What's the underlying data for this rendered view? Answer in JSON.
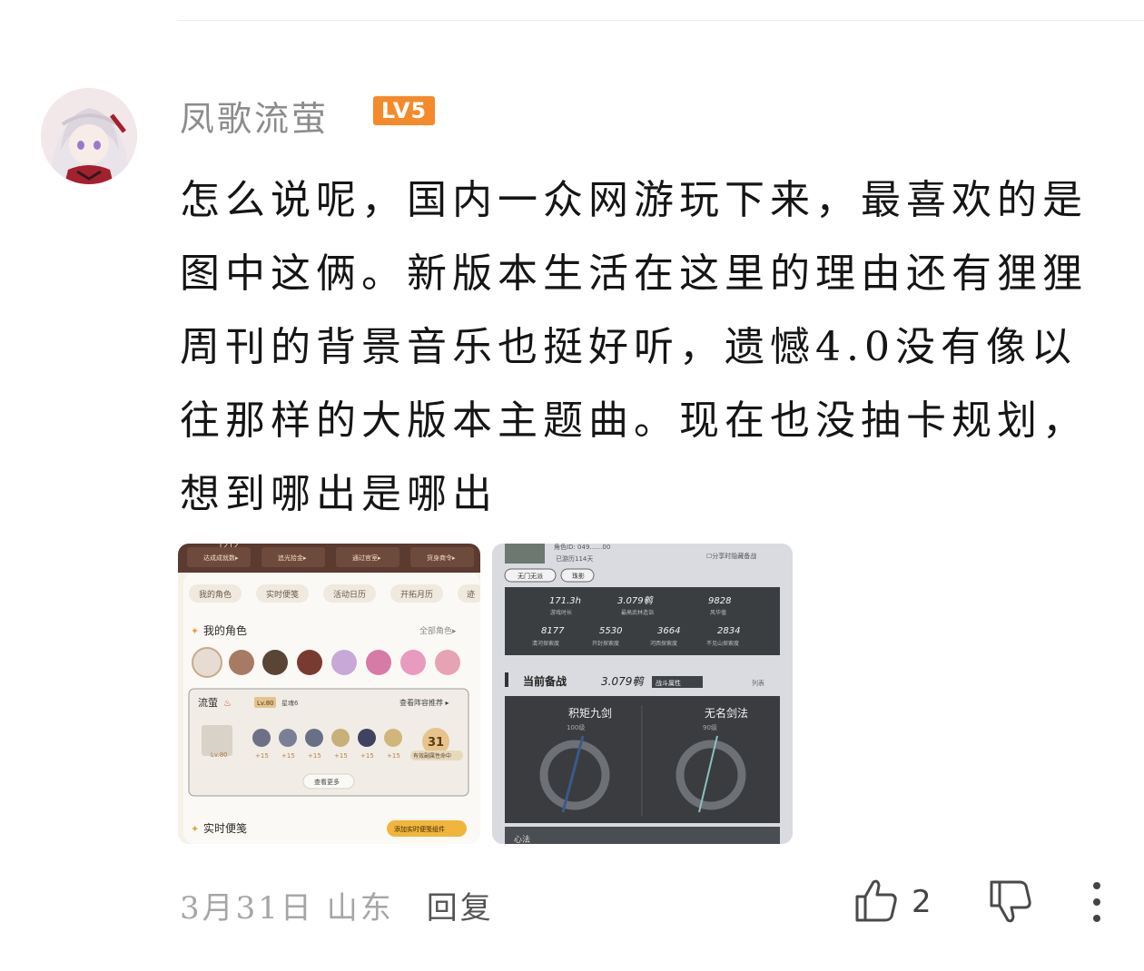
{
  "comment": {
    "username": "凤歌流萤",
    "level_badge": "LV5",
    "content": "怎么说呢，国内一众网游玩下来，最喜欢的是图中这俩。新版本生活在这里的理由还有狸狸周刊的背景音乐也挺好听，遗憾4.0没有像以往那样的大版本主题曲。现在也没抽卡规划，想到哪出是哪出",
    "date_location": "3月31日 山东",
    "reply_label": "回复",
    "like_count": "2"
  },
  "image1": {
    "top_btns": [
      "达成成就数▸",
      "追光拾金▸",
      "通过官室▸",
      "货身商令▸"
    ],
    "top_num": "1212",
    "tabs": [
      "我的角色",
      "实时便笺",
      "活动日历",
      "开拓月历",
      "迹"
    ],
    "my_chars": "我的角色",
    "all_chars": "全部角色▸",
    "char_name": "流萤",
    "char_lv": "Lv.80",
    "char_rank": "星魂6",
    "lineup_rec": "查看阵容推荐 ▸",
    "relic_lv": "Lv.80",
    "plus_vals": [
      "+15",
      "+15",
      "+15",
      "+15",
      "+15",
      "+15"
    ],
    "badge_num": "31",
    "badge_text": "有效副属性命中",
    "see_more": "查看更多",
    "notes_label": "实时便笺",
    "add_widget": "添加实时便笺组件"
  },
  "image2": {
    "role_id": "角色ID: 049……00",
    "days": "已游历114天",
    "hide_toggle": "☐分享时隐藏备战",
    "tag1": "无门无派",
    "tag2": "珠影",
    "stats_row1": [
      {
        "value": "171.3h",
        "label": "游戏时长"
      },
      {
        "value": "3.079鹌",
        "label": "最高武林造诣"
      },
      {
        "value": "9828",
        "label": "风华值"
      }
    ],
    "stats_row2": [
      {
        "value": "8177",
        "label": "清河探索度"
      },
      {
        "value": "5530",
        "label": "开封探索度"
      },
      {
        "value": "3664",
        "label": "河西探索度"
      },
      {
        "value": "2834",
        "label": "不见山探索度"
      }
    ],
    "section_title": "当前备战",
    "section_value": "3.079鹌",
    "section_tag": "战斗属性",
    "list_label": "列表",
    "weapon1_name": "积矩九剑",
    "weapon1_lv": "100级",
    "weapon2_name": "无名剑法",
    "weapon2_lv": "90级",
    "bottom_text": "心法"
  }
}
